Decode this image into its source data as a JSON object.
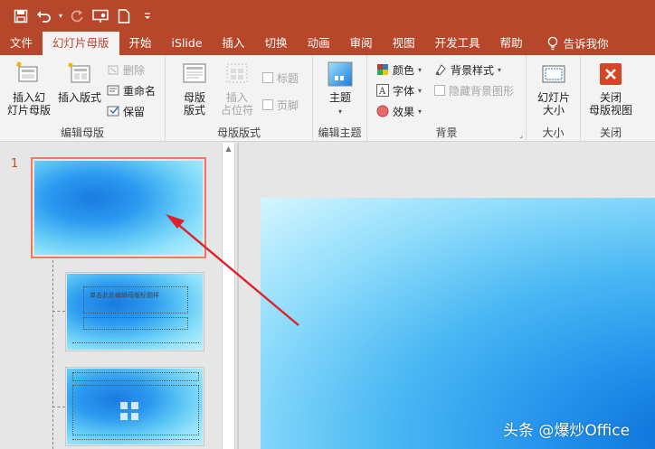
{
  "quick_access": {
    "icons": [
      "save-icon",
      "undo-icon",
      "redo-icon",
      "present-from-start-icon",
      "new-file-icon",
      "customize-icon"
    ]
  },
  "tabs": [
    {
      "label": "文件",
      "active": false
    },
    {
      "label": "幻灯片母版",
      "active": true
    },
    {
      "label": "开始",
      "active": false
    },
    {
      "label": "iSlide",
      "active": false
    },
    {
      "label": "插入",
      "active": false
    },
    {
      "label": "切换",
      "active": false
    },
    {
      "label": "动画",
      "active": false
    },
    {
      "label": "审阅",
      "active": false
    },
    {
      "label": "视图",
      "active": false
    },
    {
      "label": "开发工具",
      "active": false
    },
    {
      "label": "帮助",
      "active": false
    }
  ],
  "tell_me": "告诉我你",
  "ribbon": {
    "edit_master": {
      "label": "编辑母版",
      "insert_slide_master": "插入幻\n灯片母版",
      "insert_layout": "插入版式",
      "delete": "删除",
      "rename": "重命名",
      "preserve": "保留"
    },
    "master_layout": {
      "label": "母版版式",
      "master_layout_btn": "母版\n版式",
      "insert_placeholder": "插入\n占位符",
      "title": "标题",
      "footer": "页脚"
    },
    "edit_theme": {
      "label": "编辑主题",
      "themes": "主题"
    },
    "background": {
      "label": "背景",
      "colors": "颜色",
      "fonts": "字体",
      "effects": "效果",
      "background_styles": "背景样式",
      "hide_bg_graphics": "隐藏背景图形"
    },
    "size": {
      "label": "大小",
      "slide_size": "幻灯片\n大小"
    },
    "close": {
      "label": "关闭",
      "close_master": "关闭\n母版视图"
    }
  },
  "thumbnails": {
    "slide_number": "1",
    "layout1_title": "单击此处编辑母版标题样"
  },
  "watermark": "头条 @爆炒Office",
  "colors": {
    "accent": "#b7472a",
    "selection": "#f0795f",
    "arrow": "#e0202a"
  }
}
